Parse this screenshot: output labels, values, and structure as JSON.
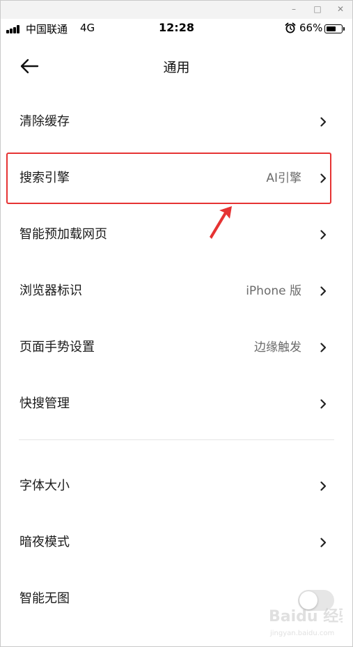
{
  "window_controls": {
    "minimize": "–",
    "maximize": "□",
    "close": "✕"
  },
  "status_bar": {
    "carrier": "中国联通",
    "network": "4G",
    "time": "12:28",
    "battery": "66%",
    "battery_level": 0.66,
    "icons": [
      "signal-bars-icon",
      "alarm-clock-icon",
      "battery-icon"
    ]
  },
  "header": {
    "title": "通用",
    "back_icon": "arrow-left-icon"
  },
  "settings": {
    "group1": [
      {
        "label": "清除缓存",
        "value": ""
      },
      {
        "label": "搜索引擎",
        "value": "AI引擎"
      },
      {
        "label": "智能预加载网页",
        "value": ""
      },
      {
        "label": "浏览器标识",
        "value": "iPhone 版"
      },
      {
        "label": "页面手势设置",
        "value": "边缘触发"
      },
      {
        "label": "快搜管理",
        "value": ""
      }
    ],
    "group2": [
      {
        "label": "字体大小",
        "value": ""
      },
      {
        "label": "暗夜模式",
        "value": ""
      },
      {
        "label": "智能无图",
        "toggle_on": false
      }
    ]
  },
  "colors": {
    "highlight": "#e63333",
    "toggle_off": "#e6e6e6"
  },
  "watermark": {
    "brand": "Baidu 经验",
    "url": "jingyan.baidu.com"
  }
}
